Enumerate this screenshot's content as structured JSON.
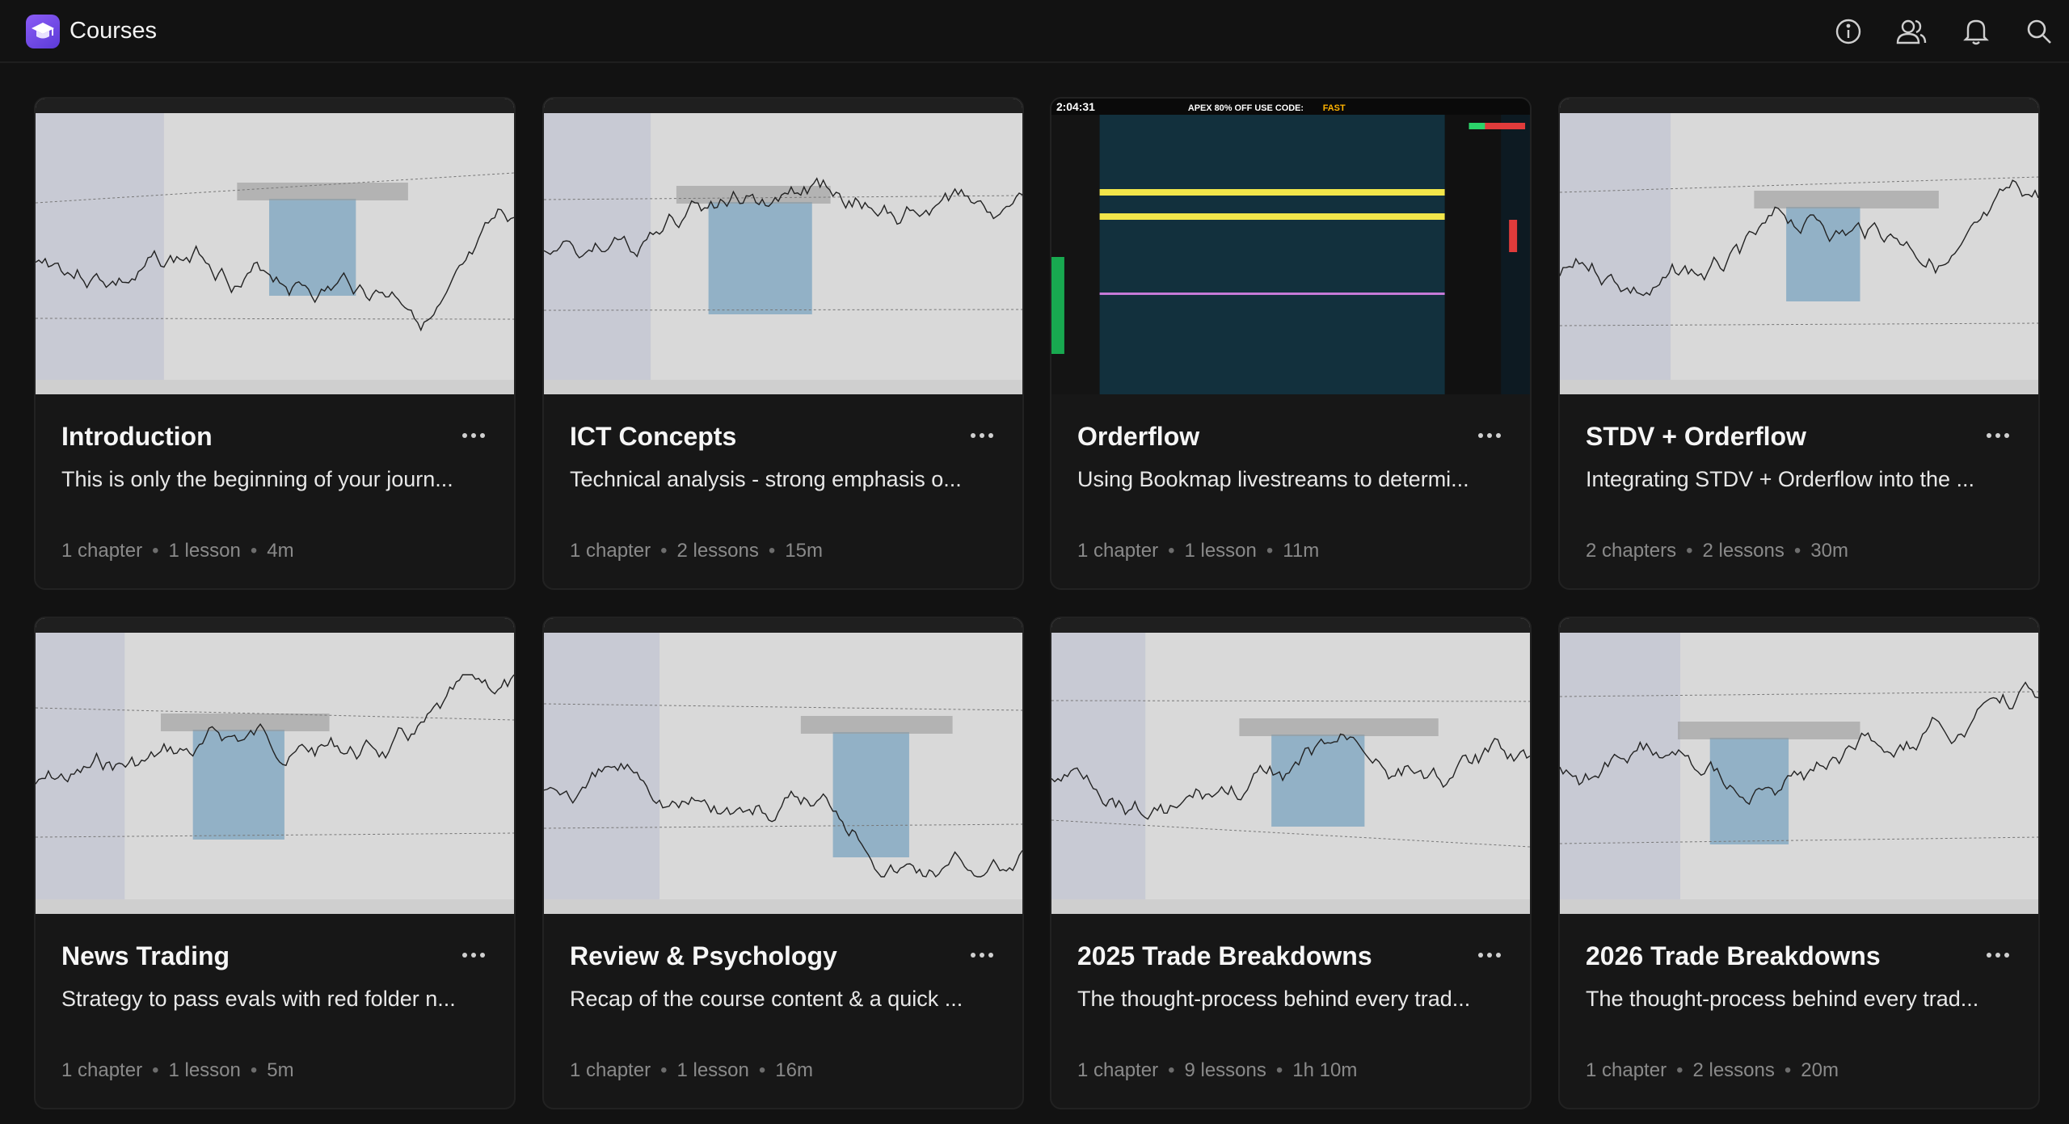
{
  "header": {
    "title": "Courses",
    "icons": [
      "info-icon",
      "users-icon",
      "bell-icon",
      "search-icon"
    ]
  },
  "courses": [
    {
      "title": "Introduction",
      "description": "This is only the beginning of your journ...",
      "chapters": "1 chapter",
      "lessons": "1 lesson",
      "duration": "4m",
      "thumbnail": "light-chart"
    },
    {
      "title": "ICT Concepts",
      "description": "Technical analysis - strong emphasis o...",
      "chapters": "1 chapter",
      "lessons": "2 lessons",
      "duration": "15m",
      "thumbnail": "light-chart"
    },
    {
      "title": "Orderflow",
      "description": "Using Bookmap livestreams to determi...",
      "chapters": "1 chapter",
      "lessons": "1 lesson",
      "duration": "11m",
      "thumbnail": "dark-heatmap",
      "thumb_text": {
        "clock": "2:04:31",
        "banner": "APEX  80% OFF USE CODE:",
        "code": "FAST"
      }
    },
    {
      "title": "STDV + Orderflow",
      "description": "Integrating STDV + Orderflow into the ...",
      "chapters": "2 chapters",
      "lessons": "2 lessons",
      "duration": "30m",
      "thumbnail": "light-chart"
    },
    {
      "title": "News Trading",
      "description": "Strategy to pass evals with red folder n...",
      "chapters": "1 chapter",
      "lessons": "1 lesson",
      "duration": "5m",
      "thumbnail": "light-chart"
    },
    {
      "title": "Review & Psychology",
      "description": "Recap of the course content & a quick ...",
      "chapters": "1 chapter",
      "lessons": "1 lesson",
      "duration": "16m",
      "thumbnail": "light-chart"
    },
    {
      "title": "2025 Trade Breakdowns",
      "description": "The thought-process behind every trad...",
      "chapters": "1 chapter",
      "lessons": "9 lessons",
      "duration": "1h 10m",
      "thumbnail": "light-chart"
    },
    {
      "title": "2026 Trade Breakdowns",
      "description": "The thought-process behind every trad...",
      "chapters": "1 chapter",
      "lessons": "2 lessons",
      "duration": "20m",
      "thumbnail": "light-chart"
    }
  ],
  "colors": {
    "accent": "#7c4dff",
    "background": "#121212",
    "card": "#171717",
    "meta": "#8a8a8a"
  }
}
